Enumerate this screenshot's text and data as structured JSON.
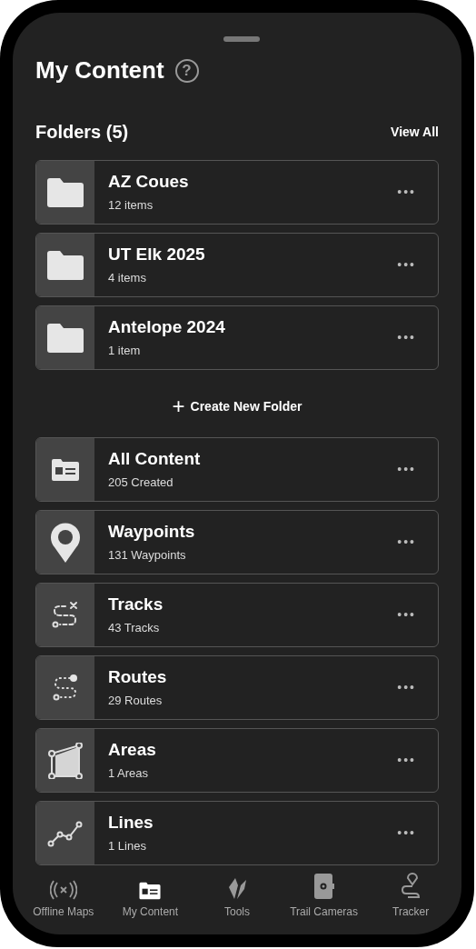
{
  "header": {
    "title": "My Content",
    "help": "?"
  },
  "folders_section": {
    "title": "Folders (5)",
    "action": "View All"
  },
  "folders": [
    {
      "kind": "folder",
      "name": "AZ Coues",
      "count": "12 items",
      "menu": "•••"
    },
    {
      "kind": "folder",
      "name": "UT Elk 2025",
      "count": "4 items",
      "menu": "•••"
    },
    {
      "kind": "folder",
      "name": "Antelope 2024",
      "count": "1 item",
      "menu": "•••"
    }
  ],
  "create_folder": {
    "icon": "+",
    "label": "Create New Folder"
  },
  "content": [
    {
      "kind": "all",
      "name": "All Content",
      "count": "205 Created",
      "menu": "•••"
    },
    {
      "kind": "waypoint",
      "name": "Waypoints",
      "count": "131 Waypoints",
      "menu": "•••"
    },
    {
      "kind": "track",
      "name": "Tracks",
      "count": "43 Tracks",
      "menu": "•••"
    },
    {
      "kind": "route",
      "name": "Routes",
      "count": "29 Routes",
      "menu": "•••"
    },
    {
      "kind": "area",
      "name": "Areas",
      "count": "1 Areas",
      "menu": "•••"
    },
    {
      "kind": "line",
      "name": "Lines",
      "count": "1 Lines",
      "menu": "•••"
    }
  ],
  "tab_bar": [
    {
      "kind": "offline",
      "label": "Offline Maps",
      "selected": false
    },
    {
      "kind": "content",
      "label": "My Content",
      "selected": true
    },
    {
      "kind": "tools",
      "label": "Tools",
      "selected": false
    },
    {
      "kind": "cameras",
      "label": "Trail Cameras",
      "selected": false
    },
    {
      "kind": "tracker",
      "label": "Tracker",
      "selected": false
    }
  ]
}
